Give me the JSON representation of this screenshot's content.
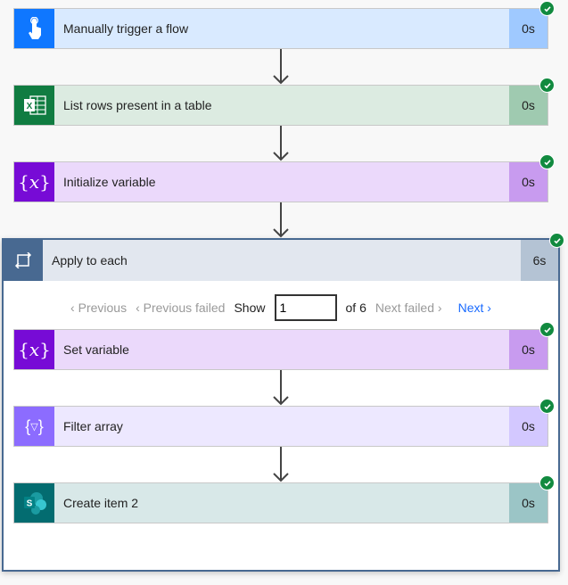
{
  "steps": [
    {
      "label": "Manually trigger a flow",
      "duration": "0s",
      "icon": "touch-trigger-icon",
      "color": "#0f77ff",
      "bg": "#d9eaff",
      "dur_bg": "#9fc9ff"
    },
    {
      "label": "List rows present in a table",
      "duration": "0s",
      "icon": "excel-icon",
      "color": "#107c41",
      "bg": "#dcebe1",
      "dur_bg": "#9fcab0"
    },
    {
      "label": "Initialize variable",
      "duration": "0s",
      "icon": "variable-icon",
      "color": "#770bd6",
      "bg": "#ebd9fb",
      "dur_bg": "#c89bef"
    }
  ],
  "loop": {
    "label": "Apply to each",
    "duration": "6s",
    "icon": "loop-icon",
    "color": "#486991",
    "pager": {
      "previous": "Previous",
      "previous_failed": "Previous failed",
      "show": "Show",
      "current": "1",
      "of": "of 6",
      "next_failed": "Next failed",
      "next": "Next"
    },
    "steps": [
      {
        "label": "Set variable",
        "duration": "0s",
        "icon": "variable-icon",
        "color": "#770bd6",
        "bg": "#ebd9fb",
        "dur_bg": "#c89bef"
      },
      {
        "label": "Filter array",
        "duration": "0s",
        "icon": "filter-array-icon",
        "color": "#8c6cff",
        "bg": "#ede8ff",
        "dur_bg": "#d3c8ff"
      },
      {
        "label": "Create item 2",
        "duration": "0s",
        "icon": "sharepoint-icon",
        "color": "#036c70",
        "bg": "#d8e8e8",
        "dur_bg": "#9bc5c6"
      }
    ]
  },
  "status_color": "#118a3f"
}
